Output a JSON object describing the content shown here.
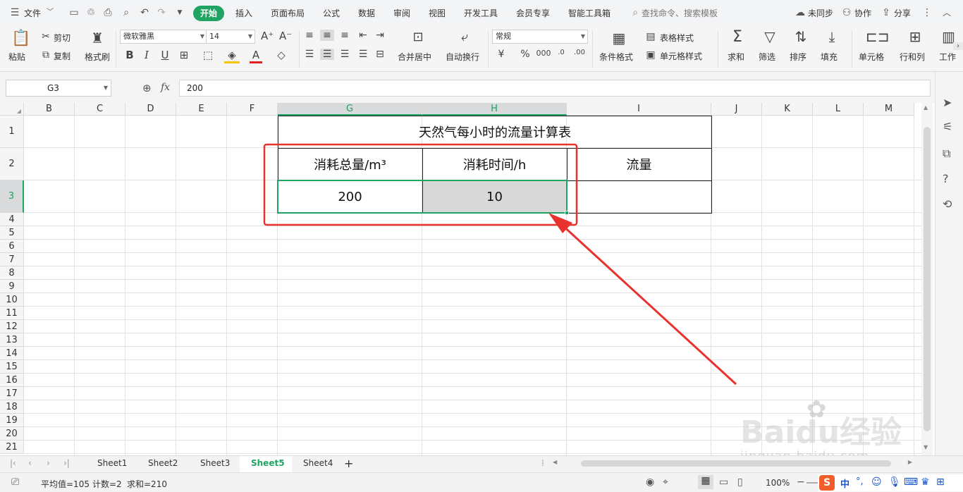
{
  "topbar": {
    "file_menu": "文件",
    "tabs": [
      "插入",
      "页面布局",
      "公式",
      "数据",
      "审阅",
      "视图",
      "开发工具",
      "会员专享",
      "智能工具箱"
    ],
    "active_tab": "开始",
    "search_placeholder": "查找命令、搜索模板",
    "sync": "未同步",
    "collab": "协作",
    "share": "分享"
  },
  "ribbon": {
    "paste": "粘贴",
    "cut": "剪切",
    "copy": "复制",
    "format_painter": "格式刷",
    "font_name": "微软雅黑",
    "font_size": "14",
    "merge_center": "合并居中",
    "wrap_text": "自动换行",
    "number_format": "常规",
    "cond_format": "条件格式",
    "table_style": "表格样式",
    "cell_style": "单元格样式",
    "sum": "求和",
    "filter": "筛选",
    "sort": "排序",
    "fill": "填充",
    "cell": "单元格",
    "row_col": "行和列",
    "worksheet": "工作"
  },
  "formula_bar": {
    "name_box": "G3",
    "fx": "fx",
    "value": "200"
  },
  "grid": {
    "col_letters": [
      "B",
      "C",
      "D",
      "E",
      "F",
      "G",
      "H",
      "I",
      "J",
      "K",
      "L",
      "M"
    ],
    "selected_cols": [
      "G",
      "H"
    ],
    "row_numbers": [
      "1",
      "2",
      "3",
      "4",
      "5",
      "6",
      "7",
      "8",
      "9",
      "10",
      "11",
      "12",
      "13",
      "14",
      "15",
      "16",
      "17",
      "18",
      "19",
      "20",
      "21"
    ],
    "selected_row": "3"
  },
  "table": {
    "title": "天然气每小时的流量计算表",
    "headers": [
      "消耗总量/m³",
      "消耗时间/h",
      "流量"
    ],
    "row": [
      "200",
      "10",
      ""
    ]
  },
  "watermark": {
    "brand": "Baidu经验",
    "url": "jingyan.baidu.com"
  },
  "sheets": {
    "tabs": [
      "Sheet1",
      "Sheet2",
      "Sheet3",
      "Sheet5",
      "Sheet4"
    ],
    "active": "Sheet5",
    "add": "+"
  },
  "status": {
    "average": "平均值=105",
    "count": "计数=2",
    "sum": "求和=210",
    "zoom": "100%",
    "ime": "中"
  },
  "colors": {
    "accent": "#1fa463",
    "annotation_red": "#e8322d"
  }
}
